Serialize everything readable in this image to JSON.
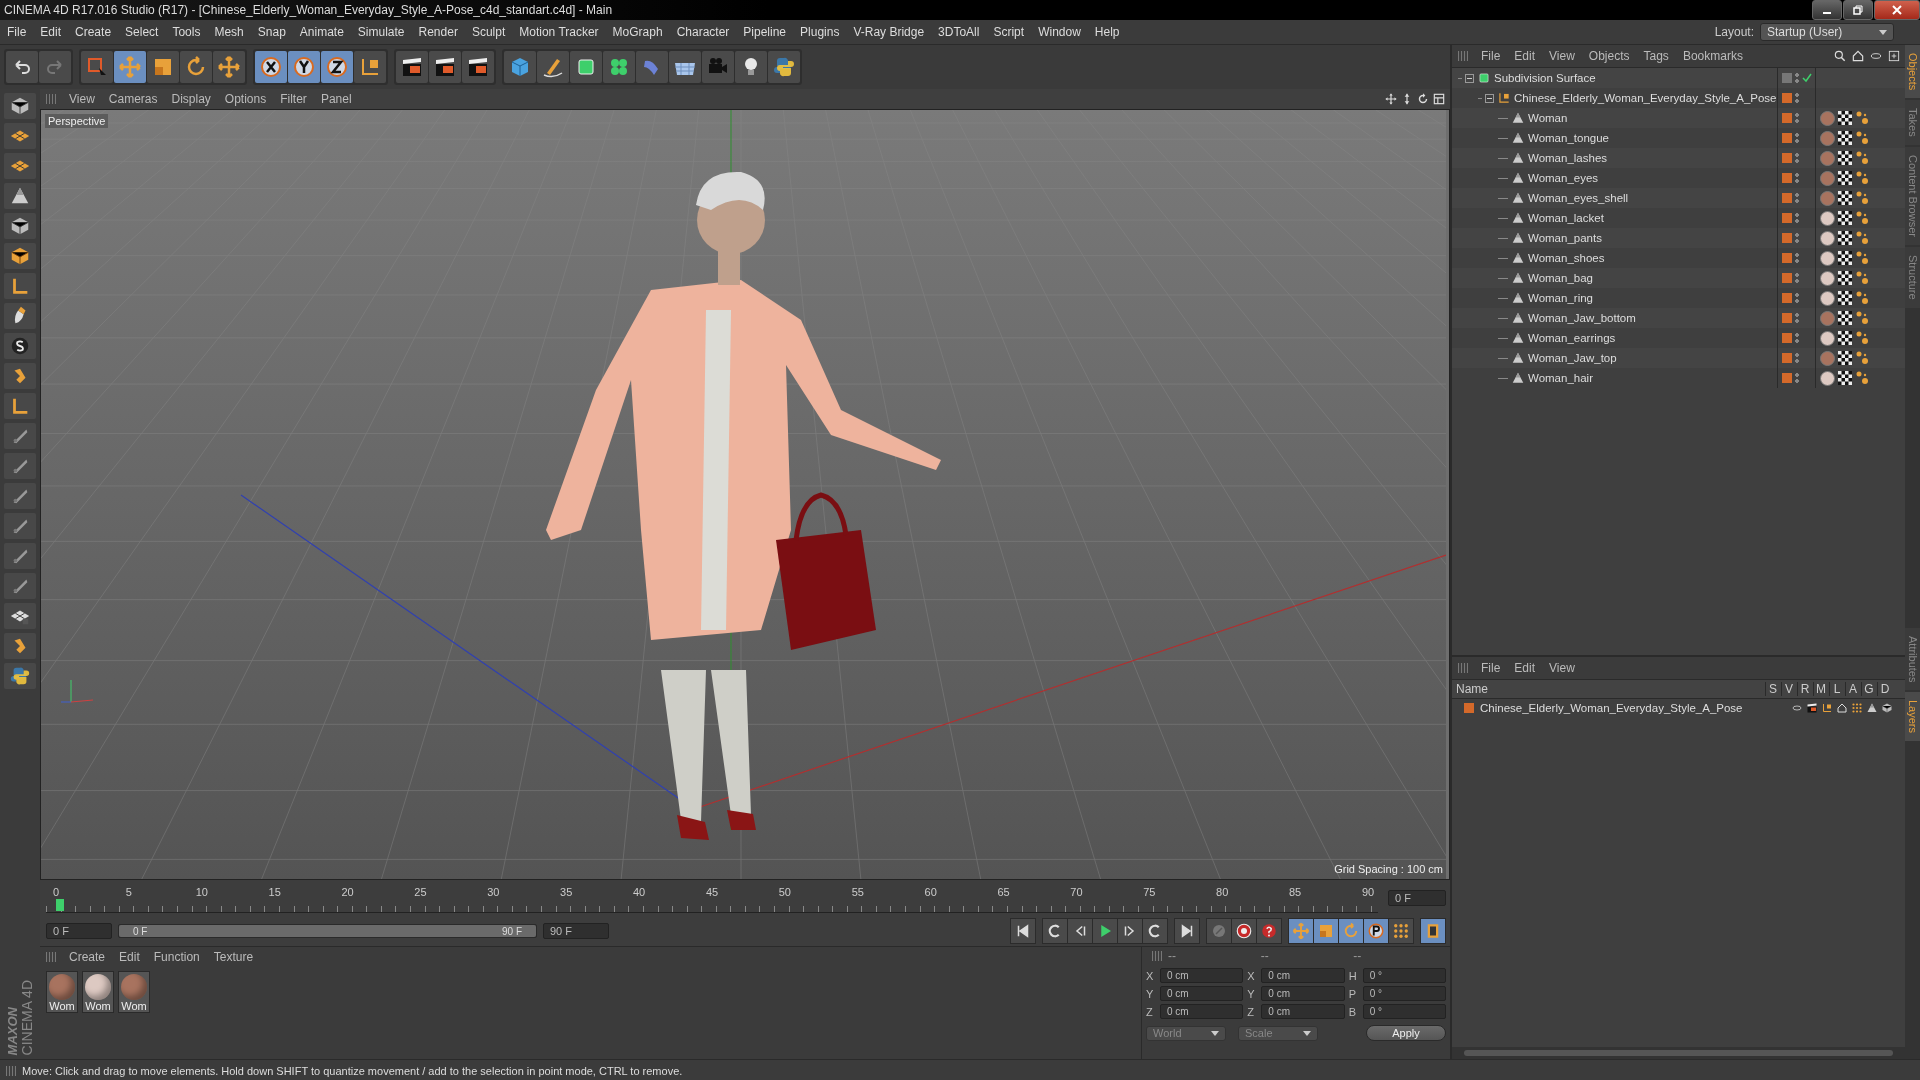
{
  "window": {
    "title": "CINEMA 4D R17.016 Studio (R17) - [Chinese_Elderly_Woman_Everyday_Style_A-Pose_c4d_standart.c4d] - Main"
  },
  "menu": [
    "File",
    "Edit",
    "Create",
    "Select",
    "Tools",
    "Mesh",
    "Snap",
    "Animate",
    "Simulate",
    "Render",
    "Sculpt",
    "Motion Tracker",
    "MoGraph",
    "Character",
    "Pipeline",
    "Plugins",
    "V-Ray Bridge",
    "3DToAll",
    "Script",
    "Window",
    "Help"
  ],
  "layout": {
    "label": "Layout:",
    "value": "Startup (User)"
  },
  "viewport": {
    "menu": [
      "View",
      "Cameras",
      "Display",
      "Options",
      "Filter",
      "Panel"
    ],
    "camera": "Perspective",
    "grid_spacing": "Grid Spacing : 100 cm"
  },
  "timeline": {
    "ticks": [
      "0",
      "5",
      "10",
      "15",
      "20",
      "25",
      "30",
      "35",
      "40",
      "45",
      "50",
      "55",
      "60",
      "65",
      "70",
      "75",
      "80",
      "85",
      "90"
    ],
    "current_frame": "0 F"
  },
  "playback": {
    "start": "0 F",
    "range_start": "0 F",
    "range_end": "90 F",
    "level": 1,
    "end": "90 F"
  },
  "materials": {
    "menu": [
      "Create",
      "Edit",
      "Function",
      "Texture"
    ],
    "items": [
      {
        "label": "Wom",
        "color": "#a8735f"
      },
      {
        "label": "Wom",
        "color": "#ddc9c2"
      },
      {
        "label": "Wom",
        "color": "#a8735f"
      }
    ]
  },
  "coordinates": {
    "headers": [
      "--",
      "--",
      "--"
    ],
    "rows": [
      {
        "cells": [
          {
            "axis": "X",
            "value": "0 cm"
          },
          {
            "axis": "X",
            "value": "0 cm"
          },
          {
            "axis": "H",
            "value": "0 °"
          }
        ]
      },
      {
        "cells": [
          {
            "axis": "Y",
            "value": "0 cm"
          },
          {
            "axis": "Y",
            "value": "0 cm"
          },
          {
            "axis": "P",
            "value": "0 °"
          }
        ]
      },
      {
        "cells": [
          {
            "axis": "Z",
            "value": "0 cm"
          },
          {
            "axis": "Z",
            "value": "0 cm"
          },
          {
            "axis": "B",
            "value": "0 °"
          }
        ]
      }
    ],
    "dropdowns": [
      "World",
      "Scale"
    ],
    "apply": "Apply"
  },
  "logo": {
    "brand": "MAXON",
    "product": "CINEMA 4D"
  },
  "status_bar": "Move: Click and drag to move elements. Hold down SHIFT to quantize movement / add to the selection in point mode, CTRL to remove.",
  "objects": {
    "menu": [
      "File",
      "Edit",
      "View",
      "Objects",
      "Tags",
      "Bookmarks"
    ],
    "tree": [
      {
        "name": "Subdivision Surface",
        "kind": "subdivision",
        "expanded": true,
        "enabled": true,
        "children": [
          {
            "name": "Chinese_Elderly_Woman_Everyday_Style_A_Pose",
            "kind": "null",
            "expanded": true,
            "children": [
              {
                "name": "Woman",
                "kind": "polygon",
                "color": "#a8735f"
              },
              {
                "name": "Woman_tongue",
                "kind": "polygon",
                "color": "#a8735f"
              },
              {
                "name": "Woman_lashes",
                "kind": "polygon",
                "color": "#a8735f"
              },
              {
                "name": "Woman_eyes",
                "kind": "polygon",
                "color": "#a8735f"
              },
              {
                "name": "Woman_eyes_shell",
                "kind": "polygon",
                "color": "#a8735f"
              },
              {
                "name": "Woman_lacket",
                "kind": "polygon",
                "color": "#ddc9c2"
              },
              {
                "name": "Woman_pants",
                "kind": "polygon",
                "color": "#ddc9c2"
              },
              {
                "name": "Woman_shoes",
                "kind": "polygon",
                "color": "#ddc9c2"
              },
              {
                "name": "Woman_bag",
                "kind": "polygon",
                "color": "#ddc9c2"
              },
              {
                "name": "Woman_ring",
                "kind": "polygon",
                "color": "#ddc9c2"
              },
              {
                "name": "Woman_Jaw_bottom",
                "kind": "polygon",
                "color": "#a8735f"
              },
              {
                "name": "Woman_earrings",
                "kind": "polygon",
                "color": "#ddc9c2"
              },
              {
                "name": "Woman_Jaw_top",
                "kind": "polygon",
                "color": "#a8735f"
              },
              {
                "name": "Woman_hair",
                "kind": "polygon",
                "color": "#ddc9c2"
              }
            ]
          }
        ]
      }
    ]
  },
  "layers": {
    "menu": [
      "File",
      "Edit",
      "View"
    ],
    "columns": [
      "Name",
      "S",
      "V",
      "R",
      "M",
      "L",
      "A",
      "G",
      "D"
    ],
    "rows": [
      {
        "name": "Chinese_Elderly_Woman_Everyday_Style_A_Pose",
        "color": "#d4692a"
      }
    ]
  },
  "side_tabs_top": [
    {
      "label": "Objects",
      "selected": true
    },
    {
      "label": "Takes",
      "selected": false
    },
    {
      "label": "Content Browser",
      "selected": false
    },
    {
      "label": "Structure",
      "selected": false
    }
  ],
  "side_tabs_bottom": [
    {
      "label": "Attributes",
      "selected": false
    },
    {
      "label": "Layers",
      "selected": true
    }
  ]
}
